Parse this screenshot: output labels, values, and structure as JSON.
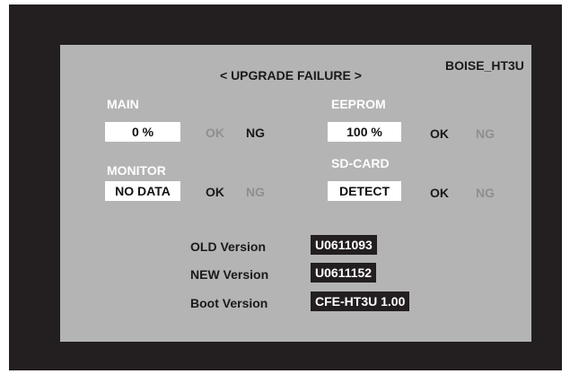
{
  "header": {
    "model": "BOISE_HT3U",
    "title": "< UPGRADE FAILURE >"
  },
  "main": {
    "label": "MAIN",
    "value": "0 %",
    "ok": "OK",
    "ng": "NG",
    "result": "NG"
  },
  "eeprom": {
    "label": "EEPROM",
    "value": "100 %",
    "ok": "OK",
    "ng": "NG",
    "result": "OK"
  },
  "monitor": {
    "label": "MONITOR",
    "value": "NO DATA",
    "ok": "OK",
    "ng": "NG",
    "result": "OK"
  },
  "sdcard": {
    "label": "SD-CARD",
    "value": "DETECT",
    "ok": "OK",
    "ng": "NG",
    "result": "OK"
  },
  "versions": {
    "old_label": "OLD Version",
    "old_value": "U0611093",
    "new_label": "NEW Version",
    "new_value": "U0611152",
    "boot_label": "Boot Version",
    "boot_value": "CFE-HT3U 1.00"
  },
  "colors": {
    "frame": "#231f20",
    "panel": "#b4b4b4",
    "active_text": "#1a1a1a",
    "inactive_text": "#8f8f8f"
  }
}
